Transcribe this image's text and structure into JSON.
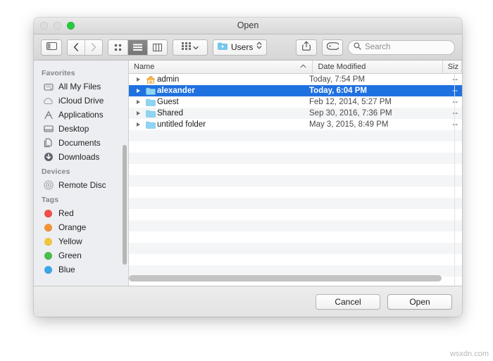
{
  "window": {
    "title": "Open",
    "traffic_lights": [
      "close",
      "minimize",
      "zoom"
    ]
  },
  "toolbar": {
    "sidebar_toggle_icon": "sidebar-toggle-icon",
    "back_label": "‹",
    "forward_label": "›",
    "view_modes": [
      {
        "name": "icon-view",
        "icon": "grid-icon",
        "selected": false
      },
      {
        "name": "list-view",
        "icon": "list-icon",
        "selected": true
      },
      {
        "name": "column-view",
        "icon": "columns-icon",
        "selected": false
      }
    ],
    "arrange_icon": "arrange-grid-icon",
    "arrange_chevron": "⌄",
    "path_popup": {
      "label": "Users",
      "icon": "blue-folder-icon"
    },
    "share_icon": "share-icon",
    "tag_icon": "tag-icon",
    "search": {
      "placeholder": "Search",
      "icon": "search-icon"
    }
  },
  "sidebar": {
    "sections": [
      {
        "header": "Favorites",
        "items": [
          {
            "label": "All My Files",
            "icon": "all-my-files-icon"
          },
          {
            "label": "iCloud Drive",
            "icon": "icloud-icon"
          },
          {
            "label": "Applications",
            "icon": "applications-icon"
          },
          {
            "label": "Desktop",
            "icon": "desktop-icon"
          },
          {
            "label": "Documents",
            "icon": "documents-icon"
          },
          {
            "label": "Downloads",
            "icon": "downloads-icon"
          }
        ]
      },
      {
        "header": "Devices",
        "items": [
          {
            "label": "Remote Disc",
            "icon": "remote-disc-icon"
          }
        ]
      },
      {
        "header": "Tags",
        "items": [
          {
            "label": "Red",
            "icon": "tag-dot",
            "color": "#f05049"
          },
          {
            "label": "Orange",
            "icon": "tag-dot",
            "color": "#f2943b"
          },
          {
            "label": "Yellow",
            "icon": "tag-dot",
            "color": "#f2c53b"
          },
          {
            "label": "Green",
            "icon": "tag-dot",
            "color": "#4bbd4c"
          },
          {
            "label": "Blue",
            "icon": "tag-dot",
            "color": "#3ba7e8"
          }
        ]
      }
    ]
  },
  "file_list": {
    "columns": [
      {
        "label": "Name",
        "sort": "ascending"
      },
      {
        "label": "Date Modified",
        "sort": null
      },
      {
        "label": "Siz",
        "sort": null
      }
    ],
    "rows": [
      {
        "name": "admin",
        "date": "Today, 7:54 PM",
        "size": "--",
        "icon": "home-folder-icon",
        "selected": false
      },
      {
        "name": "alexander",
        "date": "Today, 6:04 PM",
        "size": "--",
        "icon": "blue-folder-icon",
        "selected": true
      },
      {
        "name": "Guest",
        "date": "Feb 12, 2014, 5:27 PM",
        "size": "--",
        "icon": "blue-folder-icon",
        "selected": false
      },
      {
        "name": "Shared",
        "date": "Sep 30, 2016, 7:36 PM",
        "size": "--",
        "icon": "blue-folder-icon",
        "selected": false
      },
      {
        "name": "untitled folder",
        "date": "May 3, 2015, 8:49 PM",
        "size": "--",
        "icon": "blue-folder-icon",
        "selected": false
      }
    ]
  },
  "footer": {
    "cancel_label": "Cancel",
    "open_label": "Open"
  },
  "watermark": "wsxdn.com",
  "colors": {
    "selection_blue": "#1f71e0",
    "folder_blue": "#74c8ef",
    "sidebar_bg": "#eceef1",
    "zoom_green": "#28c940"
  }
}
